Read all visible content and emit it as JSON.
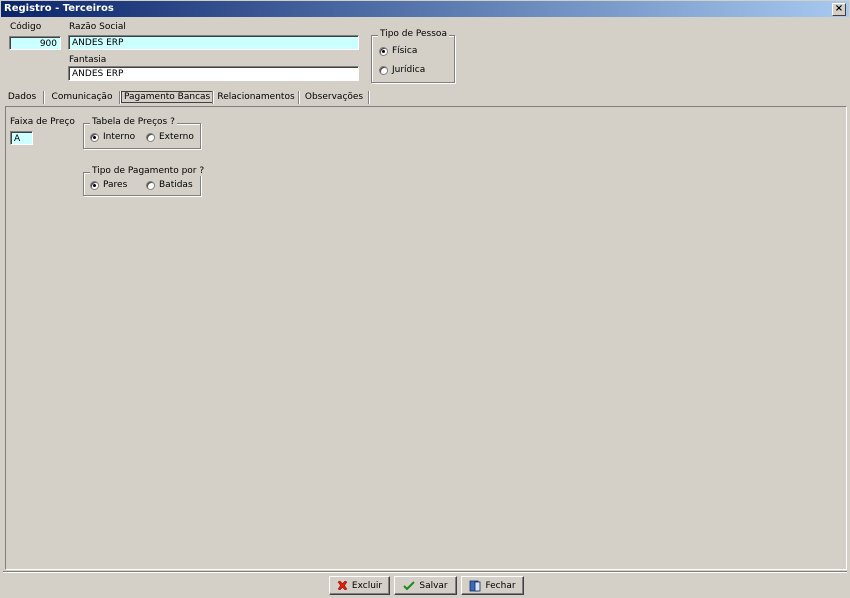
{
  "window": {
    "title": "Registro - Terceiros",
    "close_glyph": "×"
  },
  "header": {
    "codigo_label": "Código",
    "codigo_value": "900",
    "razao_label": "Razão Social",
    "razao_value": "ANDES ERP",
    "fantasia_label": "Fantasia",
    "fantasia_value": "ANDES ERP",
    "tipo_pessoa": {
      "title": "Tipo de Pessoa",
      "options": [
        "Física",
        "Jurídica"
      ],
      "selected": "Física"
    }
  },
  "tabs": [
    "Dados",
    "Comunicação",
    "Pagamento Bancas",
    "Relacionamentos",
    "Observações"
  ],
  "active_tab": "Pagamento Bancas",
  "panel": {
    "faixa_label": "Faixa de Preço",
    "faixa_value": "A",
    "tabela_precos": {
      "title": "Tabela de Preços ?",
      "options": [
        "Interno",
        "Externo"
      ],
      "selected": "Interno"
    },
    "tipo_pagamento": {
      "title": "Tipo de Pagamento por ?",
      "options": [
        "Pares",
        "Batidas"
      ],
      "selected": "Pares"
    }
  },
  "buttons": {
    "excluir": "Excluir",
    "salvar": "Salvar",
    "fechar": "Fechar"
  },
  "colors": {
    "field_highlight": "#ccffff",
    "window_bg": "#d4d0c8",
    "title_start": "#0a246a"
  }
}
